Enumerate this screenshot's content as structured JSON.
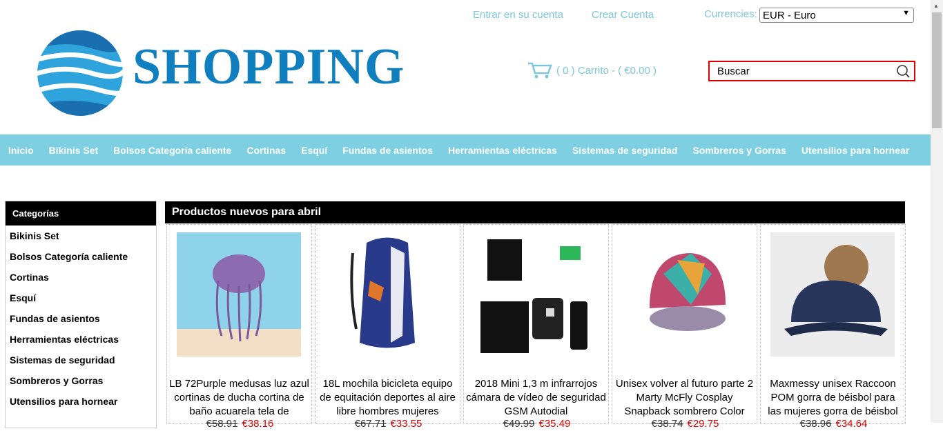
{
  "header": {
    "brand": "SHOPPING",
    "login_link": "Entrar en su cuenta",
    "register_link": "Crear Cuenta",
    "currency_label": "Currencies:",
    "currency_value": "EUR - Euro",
    "cart_text": "( 0 ) Carrito - ( €0.00 )",
    "search_placeholder": "Buscar"
  },
  "nav": [
    "Inicio",
    "Bikinis Set",
    "Bolsos Categoría caliente",
    "Cortinas",
    "Esquí",
    "Fundas de asientos",
    "Herramientas eléctricas",
    "Sistemas de seguridad",
    "Sombreros y Gorras",
    "Utensilios para hornear"
  ],
  "sidebar": {
    "title": "Categorías",
    "items": [
      "Bikinis Set",
      "Bolsos Categoría caliente",
      "Cortinas",
      "Esquí",
      "Fundas de asientos",
      "Herramientas eléctricas",
      "Sistemas de seguridad",
      "Sombreros y Gorras",
      "Utensilios para hornear"
    ]
  },
  "products_section": {
    "title": "Productos nuevos para abril",
    "items": [
      {
        "title": "LB 72Purple medusas luz azul cortinas de ducha cortina de baño acuarela tela de",
        "old_price": "€58.91",
        "new_price": "€38.16"
      },
      {
        "title": "18L mochila bicicleta equipo de equitación deportes al aire libre hombres mujeres",
        "old_price": "€67.71",
        "new_price": "€33.55"
      },
      {
        "title": "2018 Mini 1,3 m infrarrojos cámara de vídeo de seguridad GSM Autodial",
        "old_price": "€49.99",
        "new_price": "€35.49"
      },
      {
        "title": "Unisex volver al futuro parte 2 Marty McFly Cosplay Snapback sombrero Color",
        "old_price": "€38.74",
        "new_price": "€29.75"
      },
      {
        "title": "Maxmessy unisex Raccoon POM gorra de béisbol para las mujeres gorra de béisbol",
        "old_price": "€38.96",
        "new_price": "€34.64"
      }
    ]
  },
  "colors": {
    "accent": "#7fcfe2",
    "brand": "#0f7fbf",
    "highlight": "#dd0000"
  }
}
